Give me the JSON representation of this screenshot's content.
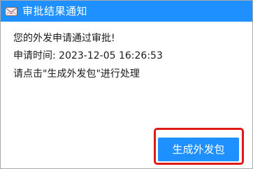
{
  "window": {
    "title": "审批结果通知",
    "title_icon": "envelope-icon",
    "accent_color": "#1e90ff"
  },
  "message": {
    "line1": "您的外发申请通过审批!",
    "line2": "申请时间: 2023-12-05 16:26:53",
    "line3": "请点击\"生成外发包\"进行处理"
  },
  "actions": {
    "generate_label": "生成外发包",
    "highlight_color": "#e01818"
  }
}
